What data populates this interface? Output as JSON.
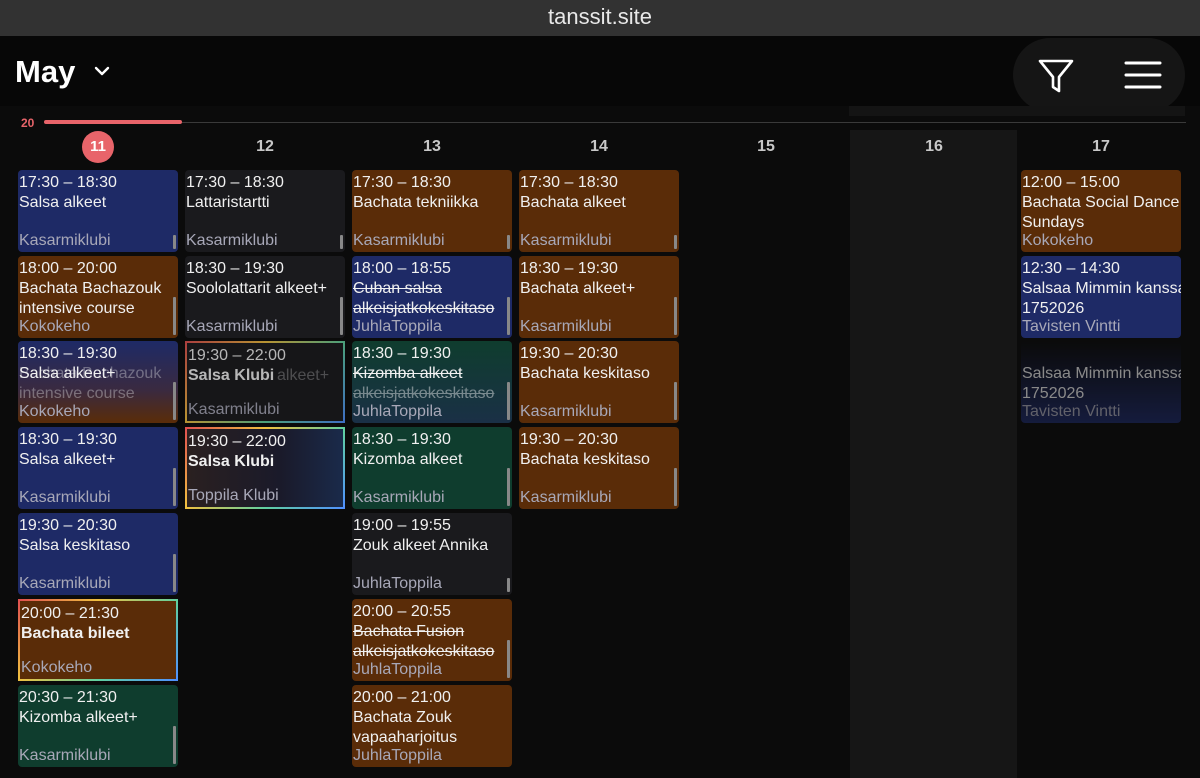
{
  "browser": {
    "url": "tanssit.site"
  },
  "header": {
    "month": "May"
  },
  "timeline": {
    "label": "20",
    "progress": 0.12
  },
  "days": [
    {
      "label": "11",
      "today": true
    },
    {
      "label": "12"
    },
    {
      "label": "13"
    },
    {
      "label": "14"
    },
    {
      "label": "15"
    },
    {
      "label": "16"
    },
    {
      "label": "17"
    }
  ],
  "events": {
    "d11": [
      {
        "time": "17:30 – 18:30",
        "name": "Salsa alkeet",
        "loc": "Kasarmiklubi",
        "color": "blue"
      },
      {
        "time": "18:00 – 20:00",
        "name": "Bachata Bachazouk intensive course",
        "loc": "Kokokeho",
        "color": "orange"
      },
      {
        "time": "18:30 – 19:30",
        "name": "Salsa alkeet+",
        "loc": "Kokokeho",
        "color": "blue",
        "ghost_name": "Bachata Bachazouk intensive course"
      },
      {
        "time": "18:30 – 19:30",
        "name": "Salsa alkeet+",
        "loc": "Kasarmiklubi",
        "color": "blue"
      },
      {
        "time": "19:30 – 20:30",
        "name": "Salsa keskitaso",
        "loc": "Kasarmiklubi",
        "color": "blue"
      },
      {
        "time": "20:00 – 21:30",
        "name": "Bachata bileet",
        "loc": "Kokokeho",
        "color": "orange",
        "featured": true
      },
      {
        "time": "20:30 – 21:30",
        "name": "Kizomba alkeet+",
        "loc": "Kasarmiklubi",
        "color": "green"
      }
    ],
    "d12": [
      {
        "time": "17:30 – 18:30",
        "name": "Lattaristartti",
        "loc": "Kasarmiklubi",
        "color": "dark"
      },
      {
        "time": "18:30 – 19:30",
        "name": "Soololattarit alkeet+",
        "loc": "Kasarmiklubi",
        "color": "dark"
      },
      {
        "time": "19:30 – 22:00",
        "name": "Salsa Klubi",
        "loc": "Kasarmiklubi",
        "color": "dark",
        "featured": true,
        "ghost_name": "alkeet+"
      },
      {
        "time": "19:30 – 22:00",
        "name": "Salsa Klubi",
        "loc": "Toppila Klubi",
        "color": "dark",
        "featured": true
      }
    ],
    "d13": [
      {
        "time": "17:30 – 18:30",
        "name": "Bachata tekniikka",
        "loc": "Kasarmiklubi",
        "color": "orange"
      },
      {
        "time": "18:00 – 18:55",
        "name": "Cuban salsa alkeisjatkokeskitaso",
        "loc": "JuhlaToppila",
        "color": "blue",
        "cancelled": true
      },
      {
        "time": "18:30 – 19:30",
        "name": "Kizomba alkeet",
        "loc": "JuhlaToppila",
        "color": "green",
        "ghost_name": "alkeisjatkokeskitaso"
      },
      {
        "time": "18:30 – 19:30",
        "name": "Kizomba alkeet",
        "loc": "Kasarmiklubi",
        "color": "green"
      },
      {
        "time": "19:00 – 19:55",
        "name": "Zouk alkeet Annika",
        "loc": "JuhlaToppila",
        "color": "dark"
      },
      {
        "time": "20:00 – 20:55",
        "name": "Bachata Fusion alkeisjatkokeskitaso",
        "loc": "JuhlaToppila",
        "color": "orange",
        "cancelled": true
      },
      {
        "time": "20:00 – 21:00",
        "name": "Bachata Zouk vapaaharjoitus",
        "loc": "JuhlaToppila",
        "color": "orange"
      }
    ],
    "d14": [
      {
        "time": "17:30 – 18:30",
        "name": "Bachata alkeet",
        "loc": "Kasarmiklubi",
        "color": "orange"
      },
      {
        "time": "18:30 – 19:30",
        "name": "Bachata alkeet+",
        "loc": "Kasarmiklubi",
        "color": "orange"
      },
      {
        "time": "19:30 – 20:30",
        "name": "Bachata keskitaso",
        "loc": "Kasarmiklubi",
        "color": "orange"
      },
      {
        "time": "19:30 – 20:30",
        "name": "Bachata keskitaso",
        "loc": "Kasarmiklubi",
        "color": "orange"
      }
    ],
    "d17": [
      {
        "time": "12:00 – 15:00",
        "name": "Bachata Social Dance Sundays",
        "loc": "Kokokeho",
        "color": "orange"
      },
      {
        "time": "12:30 – 14:30",
        "name": "Salsaa Mimmin kanssa 1752026",
        "loc": "Tavisten Vintti",
        "color": "blue"
      },
      {
        "time": "",
        "name": "Salsaa Mimmin kanssa 1752026",
        "loc": "Tavisten Vintti",
        "color": "blue",
        "ghost": true
      }
    ]
  }
}
